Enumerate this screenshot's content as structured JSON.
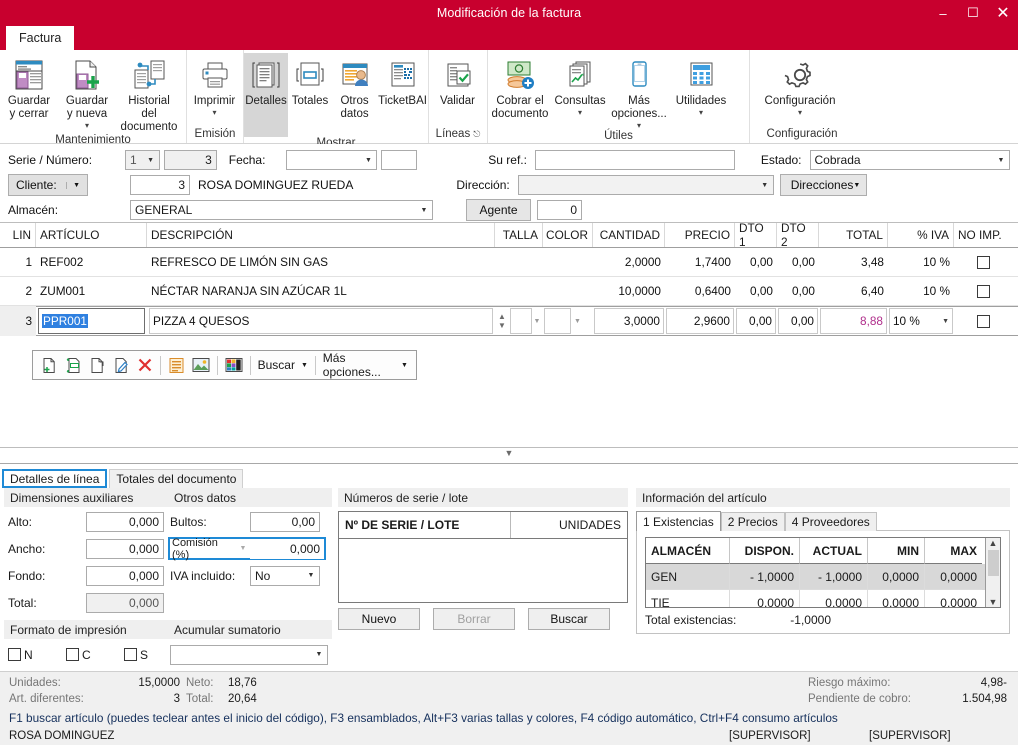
{
  "window": {
    "title": "Modificación de la factura",
    "minimize": "–",
    "maximize": "❐",
    "close": "✕"
  },
  "ribbon": {
    "tab": "Factura",
    "groups": [
      {
        "name": "Mantenimiento",
        "label": "Mantenimiento",
        "buttons": [
          {
            "label": "Guardar\ny cerrar",
            "icon": "save-close-icon",
            "caret": false
          },
          {
            "label": "Guardar\ny nueva",
            "icon": "save-new-icon",
            "caret": true
          },
          {
            "label": "Historial del\ndocumento",
            "icon": "history-icon",
            "caret": false
          }
        ]
      },
      {
        "name": "Emision",
        "label": "Emisión",
        "buttons": [
          {
            "label": "Imprimir",
            "icon": "printer-icon",
            "caret": true
          }
        ]
      },
      {
        "name": "Mostrar",
        "label": "Mostrar",
        "buttons": [
          {
            "label": "Detalles",
            "icon": "details-icon",
            "caret": false,
            "selected": true
          },
          {
            "label": "Totales",
            "icon": "totals-icon",
            "caret": false
          },
          {
            "label": "Otros\ndatos",
            "icon": "other-data-icon",
            "caret": false
          },
          {
            "label": "TicketBAI",
            "icon": "ticketbai-icon",
            "caret": false
          }
        ]
      },
      {
        "name": "Lineas",
        "label": "Líneas",
        "dialog_launcher": "⌐",
        "buttons": [
          {
            "label": "Validar",
            "icon": "validate-icon",
            "caret": false
          }
        ]
      },
      {
        "name": "Utiles",
        "label": "Útiles",
        "buttons": [
          {
            "label": "Cobrar el\ndocumento",
            "icon": "collect-money-icon",
            "caret": false
          },
          {
            "label": "Consultas",
            "icon": "queries-icon",
            "caret": true
          },
          {
            "label": "Más\nopciones...",
            "icon": "mobile-icon",
            "caret": true
          },
          {
            "label": "Utilidades",
            "icon": "calculator-icon",
            "caret": true
          }
        ]
      },
      {
        "name": "Configuracion",
        "label": "Configuración",
        "buttons": [
          {
            "label": "Configuración",
            "icon": "gear-icon",
            "caret": true
          }
        ]
      }
    ]
  },
  "header_form": {
    "serie_numero_label": "Serie / Número:",
    "serie_value": "1",
    "numero_value": "3",
    "fecha_label": "Fecha:",
    "fecha_value": "",
    "fecha_extra_value": "",
    "su_ref_label": "Su ref.:",
    "su_ref_value": "",
    "estado_label": "Estado:",
    "estado_value": "Cobrada",
    "cliente_label": "Cliente:",
    "cliente_code": "3",
    "cliente_name": "ROSA DOMINGUEZ RUEDA",
    "direccion_label": "Dirección:",
    "direccion_value": "",
    "direcciones_button": "Direcciones",
    "almacen_label": "Almacén:",
    "almacen_value": "GENERAL",
    "agente_button": "Agente",
    "agente_value": "0"
  },
  "grid": {
    "columns": [
      "LIN",
      "ARTÍCULO",
      "DESCRIPCIÓN",
      "TALLA",
      "COLOR",
      "CANTIDAD",
      "PRECIO",
      "DTO 1",
      "DTO 2",
      "TOTAL",
      "% IVA",
      "NO IMP."
    ],
    "rows": [
      {
        "lin": "1",
        "articulo": "REF002",
        "descripcion": "REFRESCO DE LIMÓN SIN GAS",
        "talla": "",
        "color": "",
        "cantidad": "2,0000",
        "precio": "1,7400",
        "dto1": "0,00",
        "dto2": "0,00",
        "total": "3,48",
        "iva": "10 %",
        "no_imp": false
      },
      {
        "lin": "2",
        "articulo": "ZUM001",
        "descripcion": "NÉCTAR NARANJA SIN AZÚCAR 1L",
        "talla": "",
        "color": "",
        "cantidad": "10,0000",
        "precio": "0,6400",
        "dto1": "0,00",
        "dto2": "0,00",
        "total": "6,40",
        "iva": "10 %",
        "no_imp": false
      },
      {
        "lin": "3",
        "articulo": "PPR001",
        "descripcion": "PIZZA 4 QUESOS",
        "talla": "",
        "color": "",
        "cantidad": "3,0000",
        "precio": "2,9600",
        "dto1": "0,00",
        "dto2": "0,00",
        "total": "8,88",
        "iva": "10 %",
        "no_imp": false,
        "editing": true
      }
    ]
  },
  "line_toolbar": {
    "icons": [
      "new-line-icon",
      "insert-line-icon",
      "copy-line-icon",
      "edit-line-icon",
      "delete-line-icon",
      "note-icon",
      "image-icon",
      "colors-icon"
    ],
    "buscar_label": "Buscar",
    "mas_opciones_label": "Más opciones..."
  },
  "bottom_tabs": [
    {
      "label": "Detalles de línea",
      "active": true
    },
    {
      "label": "Totales del documento",
      "active": false
    }
  ],
  "dimensiones": {
    "title": "Dimensiones auxiliares",
    "fields": [
      {
        "label": "Alto:",
        "value": "0,000"
      },
      {
        "label": "Ancho:",
        "value": "0,000"
      },
      {
        "label": "Fondo:",
        "value": "0,000"
      },
      {
        "label": "Total:",
        "value": "0,000",
        "readonly": true
      }
    ],
    "formato_title": "Formato de impresión",
    "formato_options": [
      "N",
      "C",
      "S"
    ]
  },
  "otros_datos": {
    "title": "Otros datos",
    "bultos_label": "Bultos:",
    "bultos_value": "0,00",
    "comision_label": "Comisión (%)",
    "comision_value": "0,000",
    "iva_incluido_label": "IVA incluido:",
    "iva_incluido_value": "No",
    "acumular_title": "Acumular sumatorio",
    "acumular_value": ""
  },
  "series": {
    "title": "Números de serie / lote",
    "col_serie": "Nº DE SERIE / LOTE",
    "col_unidades": "UNIDADES",
    "rows": [],
    "buttons": [
      {
        "label": "Nuevo",
        "enabled": true
      },
      {
        "label": "Borrar",
        "enabled": false
      },
      {
        "label": "Buscar",
        "enabled": true
      }
    ]
  },
  "info_articulo": {
    "title": "Información del artículo",
    "tabs": [
      {
        "label": "1 Existencias",
        "active": true
      },
      {
        "label": "2 Precios",
        "active": false
      },
      {
        "label": "4 Proveedores",
        "active": false
      }
    ],
    "columns": [
      "ALMACÉN",
      "DISPON.",
      "ACTUAL",
      "MIN",
      "MAX"
    ],
    "rows": [
      {
        "almacen": "GEN",
        "dispon": "- 1,0000",
        "actual": "- 1,0000",
        "min": "0,0000",
        "max": "0,0000",
        "selected": true
      },
      {
        "almacen": "TIE",
        "dispon": "0,0000",
        "actual": "0,0000",
        "min": "0,0000",
        "max": "0,0000",
        "selected": false
      }
    ],
    "total_label": "Total existencias:",
    "total_value": "-1,0000"
  },
  "status": {
    "unidades_label": "Unidades:",
    "unidades_value": "15,0000",
    "art_label": "Art. diferentes:",
    "art_value": "3",
    "neto_label": "Neto:",
    "neto_value": "18,76",
    "total_label": "Total:",
    "total_value": "20,64",
    "riesgo_label": "Riesgo máximo:",
    "riesgo_value": "4,98-",
    "pendiente_label": "Pendiente de cobro:",
    "pendiente_value": "1.504,98",
    "hint": "F1 buscar artículo (puedes teclear antes el inicio del código), F3 ensamblados, Alt+F3 varias tallas y colores, F4 código automático, Ctrl+F4 consumo artículos",
    "user": "ROSA DOMINGUEZ",
    "supervisor1": "[SUPERVISOR]",
    "supervisor2": "[SUPERVISOR]"
  },
  "colors": {
    "brand": "#c8002e",
    "accent": "#1e8ad6",
    "edit_total": "#b0308c"
  }
}
